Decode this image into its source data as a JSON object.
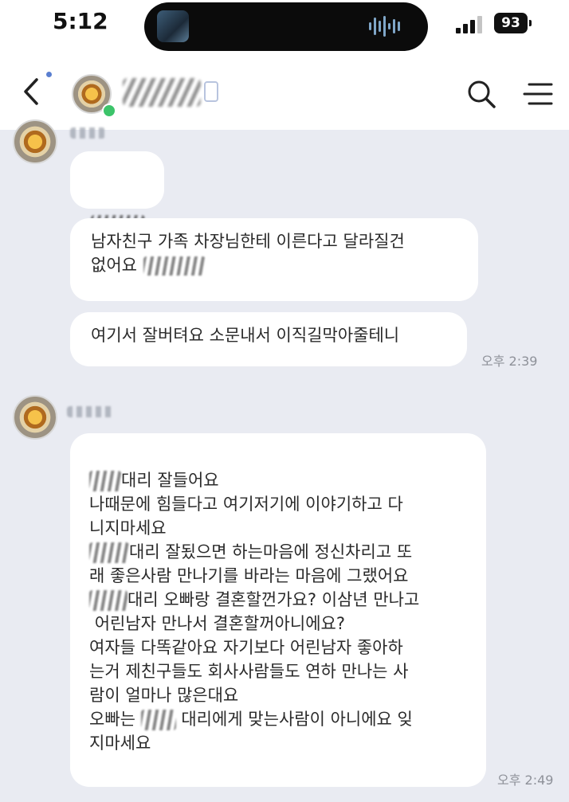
{
  "status_bar": {
    "time": "5:12",
    "battery": "93"
  },
  "header": {
    "back_icon": "chevron-left-icon",
    "search_icon": "search-icon",
    "menu_icon": "menu-icon"
  },
  "messages": {
    "group1": {
      "bubble2": "남자친구 가족 차장님한테 이른다고 달라질건\n없어요",
      "bubble3": "여기서 잘버텨요 소문내서 이직길막아줄테니",
      "time": "오후 2:39"
    },
    "group2": {
      "line1": "대리 잘들어요",
      "line2": "나때문에 힘들다고 여기저기에 이야기하고 다\n니지마세요",
      "line3a": "대리 잘됬으면 하는마음에 정신차리고 또\n래 좋은사람 만나기를 바라는 마음에 그랬어요",
      "line4a": "대리 오빠랑 결혼할껀가요? 이삼년 만나고\n 어린남자 만나서 결혼할꺼아니에요?",
      "line5": "여자들 다똑같아요 자기보다 어린남자 좋아하\n는거 제친구들도 회사사람들도 연하 만나는 사\n람이 얼마나 많은대요",
      "line6a": "오빠는",
      "line6b": "대리에게 맞는사람이 아니에요 잊\n지마세요",
      "time": "오후 2:49"
    }
  }
}
